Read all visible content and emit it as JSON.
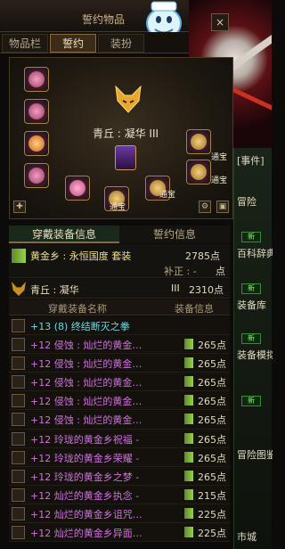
{
  "window": {
    "title": "誓约物品",
    "close_label": "×"
  },
  "tabs": [
    {
      "label": "物品栏"
    },
    {
      "label": "誓约"
    },
    {
      "label": "装扮"
    }
  ],
  "equip": {
    "set_name": "青丘 : 凝华 III",
    "treasure_label": "通宝"
  },
  "sub_tabs": [
    {
      "label": "穿戴装备信息"
    },
    {
      "label": "誓约信息"
    }
  ],
  "set_info": {
    "row1_name": "黄金乡 : 永恒国度  套装",
    "row1_points": "2785点",
    "correction_label": "补正 : -",
    "correction_points": "点",
    "row2_name": "青丘 : 凝华",
    "row2_level": "III",
    "row2_points": "2310点"
  },
  "list_header": {
    "col1": "穿戴装备名称",
    "col2": "装备信息"
  },
  "items": [
    {
      "name": "+13 (8) 终结断灭之拳",
      "color": "#66d9e0",
      "points": ""
    },
    {
      "name": "+12 侵蚀 : 灿烂的黄金…",
      "color": "#d070e0",
      "points": "265点"
    },
    {
      "name": "+12 侵蚀 : 灿烂的黄金…",
      "color": "#d070e0",
      "points": "265点"
    },
    {
      "name": "+12 侵蚀 : 灿烂的黄金…",
      "color": "#d070e0",
      "points": "265点"
    },
    {
      "name": "+12 侵蚀 : 灿烂的黄金…",
      "color": "#d070e0",
      "points": "265点"
    },
    {
      "name": "+12 侵蚀 : 灿烂的黄金…",
      "color": "#d070e0",
      "points": "265点"
    },
    {
      "name": "+12 玲珑的黄金乡祝福 -",
      "color": "#d070e0",
      "points": "265点"
    },
    {
      "name": "+12 玲珑的黄金乡荣耀 -",
      "color": "#d070e0",
      "points": "265点"
    },
    {
      "name": "+12 玲珑的黄金乡之梦 -",
      "color": "#d070e0",
      "points": "265点"
    },
    {
      "name": "+12 灿烂的黄金乡执念 -",
      "color": "#d070e0",
      "points": "215点"
    },
    {
      "name": "+12 灿烂的黄金乡诅咒…",
      "color": "#d070e0",
      "points": "225点"
    },
    {
      "name": "+12 灿烂的黄金乡异面…",
      "color": "#d070e0",
      "points": "225点"
    }
  ],
  "right_strip": {
    "labels": [
      "[事件]",
      "冒险",
      "百科辞典",
      "装备库",
      "装备模拟",
      "冒险图鉴",
      "市城"
    ],
    "new_badge": "新"
  }
}
